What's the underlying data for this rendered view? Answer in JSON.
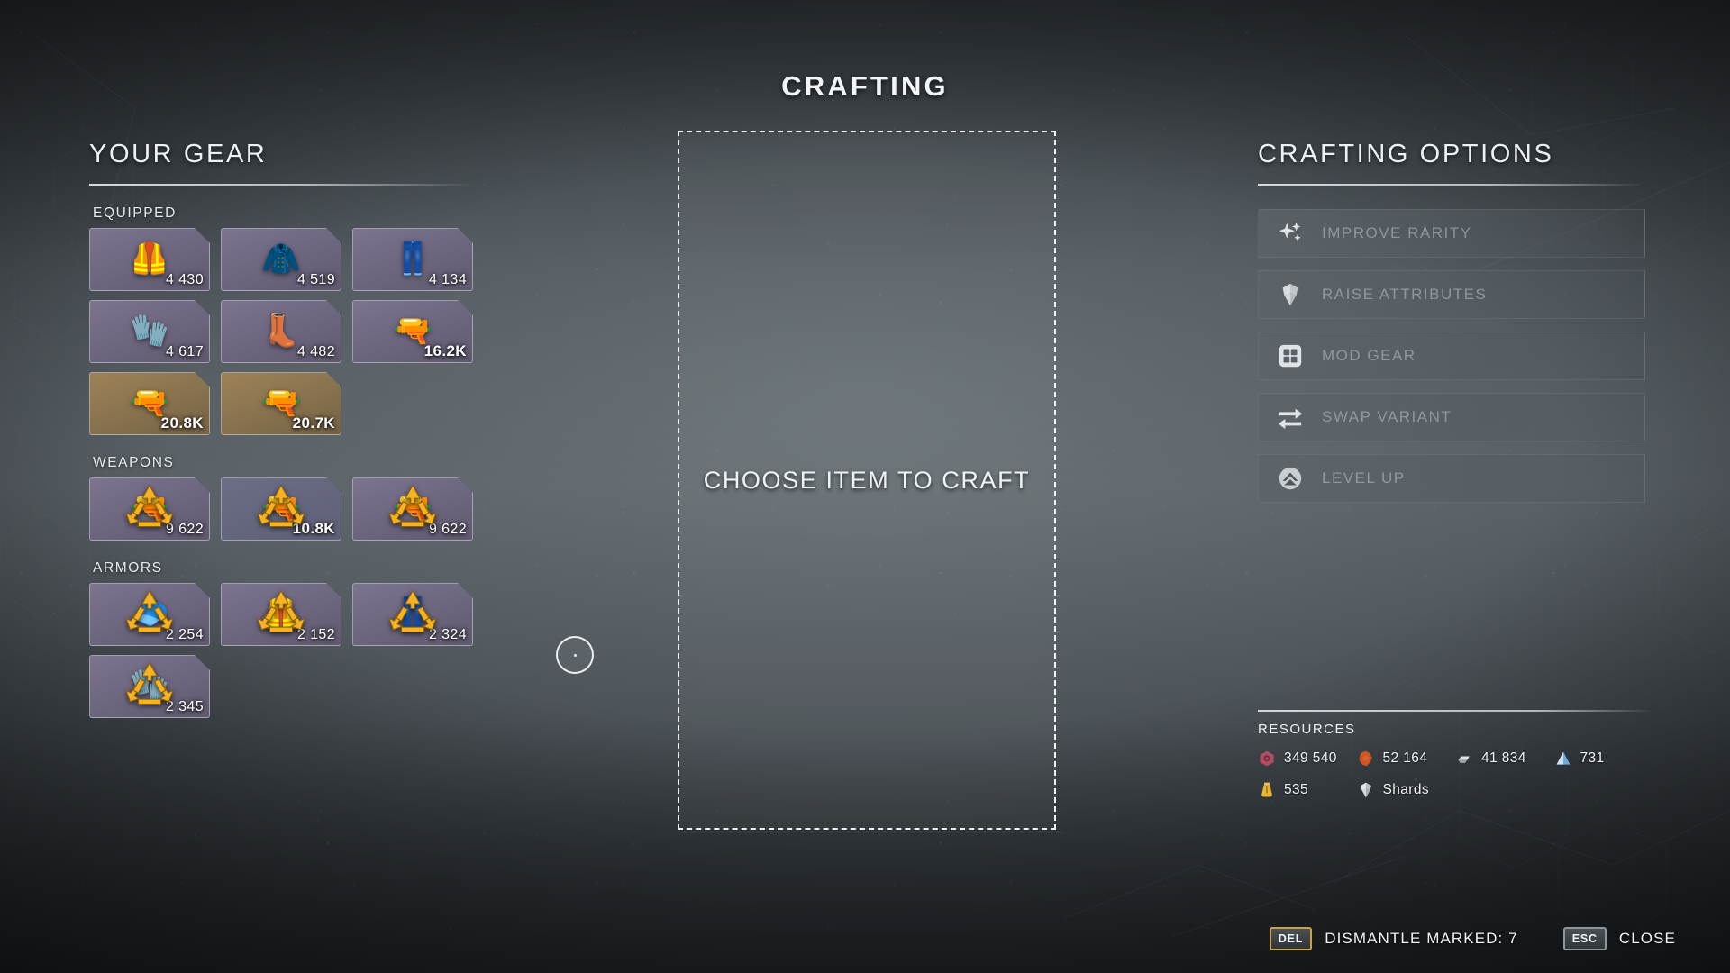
{
  "title": "CRAFTING",
  "gear": {
    "heading": "YOUR GEAR",
    "sections": [
      {
        "label": "EQUIPPED",
        "items": [
          {
            "power": "4 430",
            "rarity": "epic",
            "icon": "torso-armor-icon",
            "glyph": "🦺",
            "marked": false
          },
          {
            "power": "4 519",
            "rarity": "epic",
            "icon": "shoulder-armor-icon",
            "glyph": "🧥",
            "marked": false
          },
          {
            "power": "4 134",
            "rarity": "epic",
            "icon": "leg-armor-icon",
            "glyph": "👖",
            "marked": false
          },
          {
            "power": "4 617",
            "rarity": "epic",
            "icon": "glove-armor-icon",
            "glyph": "🧤",
            "marked": false
          },
          {
            "power": "4 482",
            "rarity": "epic",
            "icon": "boots-armor-icon",
            "glyph": "👢",
            "marked": false
          },
          {
            "power": "16.2K",
            "rarity": "epic",
            "icon": "pistol-icon",
            "glyph": "🔫",
            "marked": false
          },
          {
            "power": "20.8K",
            "rarity": "legendary",
            "icon": "rifle-icon",
            "glyph": "🔫",
            "marked": false
          },
          {
            "power": "20.7K",
            "rarity": "legendary",
            "icon": "shotgun-icon",
            "glyph": "🔫",
            "marked": false
          }
        ]
      },
      {
        "label": "WEAPONS",
        "items": [
          {
            "power": "9 622",
            "rarity": "epic",
            "icon": "assault-rifle-icon",
            "glyph": "🔫",
            "marked": true
          },
          {
            "power": "10.8K",
            "rarity": "rare",
            "icon": "energy-rifle-icon",
            "glyph": "🔫",
            "marked": true
          },
          {
            "power": "9 622",
            "rarity": "epic",
            "icon": "sniper-rifle-icon",
            "glyph": "🔫",
            "marked": true
          }
        ]
      },
      {
        "label": "ARMORS",
        "items": [
          {
            "power": "2 254",
            "rarity": "epic",
            "icon": "helmet-armor-icon",
            "glyph": "🧢",
            "marked": true
          },
          {
            "power": "2 152",
            "rarity": "epic",
            "icon": "chest-armor-icon",
            "glyph": "🦺",
            "marked": true
          },
          {
            "power": "2 324",
            "rarity": "epic",
            "icon": "pants-armor-icon",
            "glyph": "👖",
            "marked": true
          },
          {
            "power": "2 345",
            "rarity": "epic",
            "icon": "gauntlet-armor-icon",
            "glyph": "🧤",
            "marked": true
          }
        ]
      }
    ]
  },
  "craft_area": {
    "placeholder": "CHOOSE ITEM TO CRAFT"
  },
  "options": {
    "heading": "CRAFTING OPTIONS",
    "items": [
      {
        "label": "IMPROVE RARITY",
        "icon": "sparkles-icon",
        "enabled": false
      },
      {
        "label": "RAISE ATTRIBUTES",
        "icon": "gem-shield-icon",
        "enabled": false
      },
      {
        "label": "MOD GEAR",
        "icon": "grid-squares-icon",
        "enabled": false
      },
      {
        "label": "SWAP VARIANT",
        "icon": "swap-arrows-icon",
        "enabled": false
      },
      {
        "label": "LEVEL UP",
        "icon": "chevron-up-circle-icon",
        "enabled": false
      }
    ]
  },
  "resources": {
    "title": "RESOURCES",
    "items": [
      {
        "name": "leather",
        "value": "349 540",
        "icon": "leather-icon",
        "color": "#c4536a"
      },
      {
        "name": "scrap",
        "value": "52 164",
        "icon": "scrap-icon",
        "color": "#d1552a"
      },
      {
        "name": "iron",
        "value": "41 834",
        "icon": "iron-bar-icon",
        "color": "#b9bfc4"
      },
      {
        "name": "titanium",
        "value": "731",
        "icon": "titanium-icon",
        "color": "#8fc4e8"
      },
      {
        "name": "drop-pod-res",
        "value": "535",
        "icon": "capsule-icon",
        "color": "#e0b23a"
      },
      {
        "name": "shards",
        "value": "Shards",
        "icon": "shard-icon",
        "color": "#dfe3e6"
      }
    ]
  },
  "bottom_bar": {
    "dismantle_key": "DEL",
    "dismantle_label": "DISMANTLE MARKED: 7",
    "close_key": "ESC",
    "close_label": "CLOSE"
  },
  "colors": {
    "accent_gold": "#e8a020",
    "legendary": "#9d8257",
    "epic": "#7d7490",
    "key_gold": "#c9a24a"
  }
}
